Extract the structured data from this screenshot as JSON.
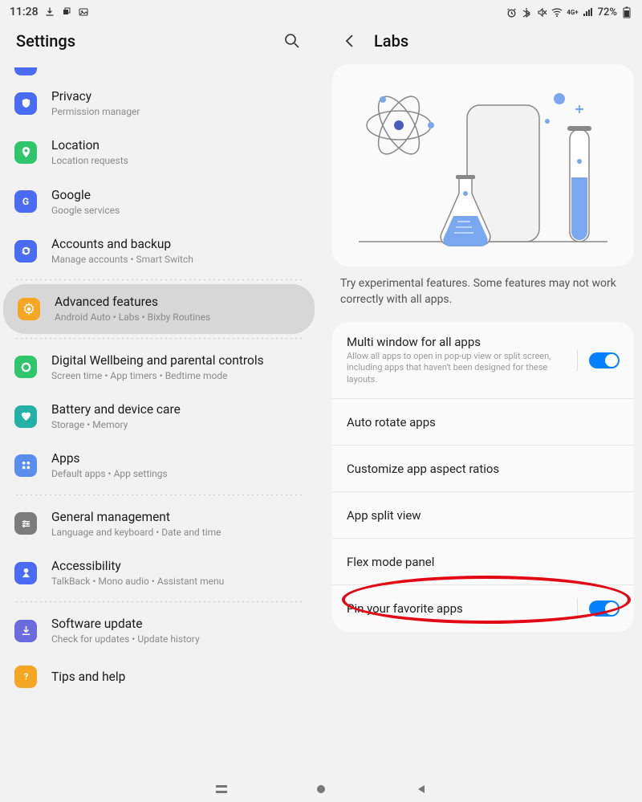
{
  "status": {
    "time": "11:28",
    "battery": "72%"
  },
  "left": {
    "title": "Settings",
    "items": [
      {
        "icon_bg": "#4a6cf5",
        "title": "Privacy",
        "sub": "Permission manager",
        "glyph": "shield"
      },
      {
        "icon_bg": "#2fc56a",
        "title": "Location",
        "sub": "Location requests",
        "glyph": "pin"
      },
      {
        "icon_bg": "#4a6cf5",
        "title": "Google",
        "sub": "Google services",
        "glyph": "google"
      },
      {
        "icon_bg": "#4a6cf5",
        "title": "Accounts and backup",
        "sub": "Manage accounts  •  Smart Switch",
        "glyph": "sync"
      }
    ],
    "selected": {
      "icon_bg": "#f5a623",
      "title": "Advanced features",
      "sub": "Android Auto  •  Labs  •  Bixby Routines",
      "glyph": "gear"
    },
    "items2": [
      {
        "icon_bg": "#2fc56a",
        "title": "Digital Wellbeing and parental controls",
        "sub": "Screen time  •  App timers  •  Bedtime mode",
        "glyph": "circle"
      },
      {
        "icon_bg": "#23b1a5",
        "title": "Battery and device care",
        "sub": "Storage  •  Memory",
        "glyph": "heart"
      },
      {
        "icon_bg": "#5b8def",
        "title": "Apps",
        "sub": "Default apps  •  App settings",
        "glyph": "grid"
      }
    ],
    "items3": [
      {
        "icon_bg": "#7b7b7b",
        "title": "General management",
        "sub": "Language and keyboard  •  Date and time",
        "glyph": "sliders"
      },
      {
        "icon_bg": "#4a6cf5",
        "title": "Accessibility",
        "sub": "TalkBack  •  Mono audio  •  Assistant menu",
        "glyph": "person"
      }
    ],
    "items4": [
      {
        "icon_bg": "#6b6be0",
        "title": "Software update",
        "sub": "Check for updates  •  Update history",
        "glyph": "download"
      },
      {
        "icon_bg": "#f5a623",
        "title": "Tips and help",
        "sub": "",
        "glyph": "question"
      }
    ]
  },
  "right": {
    "title": "Labs",
    "desc": "Try experimental features. Some features may not work correctly with all apps.",
    "rows": [
      {
        "title": "Multi window for all apps",
        "sub": "Allow all apps to open in pop-up view or split screen, including apps that haven't been designed for these layouts.",
        "toggle": true
      },
      {
        "title": "Auto rotate apps"
      },
      {
        "title": "Customize app aspect ratios"
      },
      {
        "title": "App split view"
      },
      {
        "title": "Flex mode panel"
      },
      {
        "title": "Pin your favorite apps",
        "toggle": true
      }
    ]
  }
}
